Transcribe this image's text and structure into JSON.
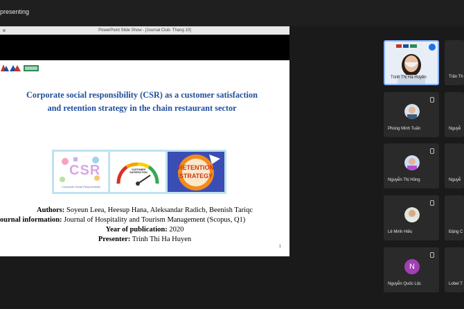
{
  "meeting": {
    "presenting_label": "presenting"
  },
  "ppt_window": {
    "title": "PowerPoint Slide Show - [Journal Club- Thang 10]"
  },
  "slide": {
    "title_line1": "Corporate social responsibility (CSR) as a customer satisfaction",
    "title_line2": "and retention strategy in the chain restaurant sector",
    "images": {
      "csr_label": "Corporate Social Responsibility",
      "csr_big": "CSR",
      "cs_label": "CUSTOMER SATISFACTION",
      "rs_line1": "RETENTION",
      "rs_line2": "STRATEGY"
    },
    "authors_label": "Authors:",
    "authors_value": " Soyeun Leea, Heesup Hana, Aleksandar Radicb, Beenish Tariqc",
    "journal_label": "ournal information:",
    "journal_value": " Journal of Hospitality and Tourism Management (Scopus, Q1)",
    "year_label": "Year of publication:",
    "year_value": " 2020",
    "presenter_label": "Presenter:",
    "presenter_value": " Trinh Thi Ha Huyen",
    "page_number": "1"
  },
  "participants": [
    {
      "name": "Trịnh Thị Hà Huyền",
      "type": "video"
    },
    {
      "name": "Trần Th",
      "type": "partial"
    },
    {
      "name": "Phùng Minh Tuấn",
      "type": "avatar"
    },
    {
      "name": "Nguyễ",
      "type": "partial"
    },
    {
      "name": "Nguyễn Thị Hồng",
      "type": "avatar"
    },
    {
      "name": "Nguyễ",
      "type": "partial"
    },
    {
      "name": "Lê Minh Hiếu",
      "type": "avatar"
    },
    {
      "name": "Đặng C",
      "type": "partial"
    },
    {
      "name": "Nguyễn Quốc Lộc",
      "type": "initial",
      "initial": "N"
    },
    {
      "name": "Lobel T",
      "type": "partial"
    }
  ],
  "colors": {
    "title_blue": "#1f4e9b",
    "initial_avatar": "#a13fb5",
    "active_border": "#8ab4f8"
  }
}
